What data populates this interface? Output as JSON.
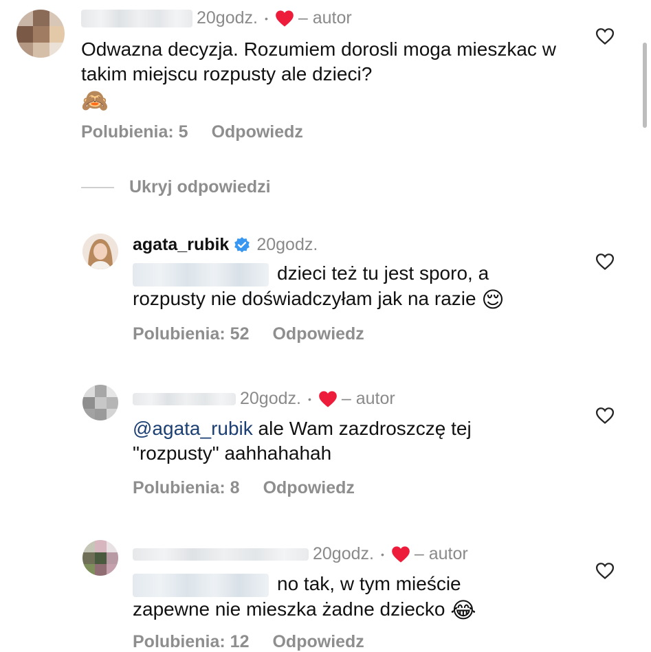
{
  "comments": [
    {
      "time": "20godz.",
      "author_label": "– autor",
      "text": "Odwazna decyzja. Rozumiem dorosli moga mieszkac w takim miejscu rozpusty ale dzieci?",
      "emoji": "🙈",
      "likes_label": "Polubienia: 5",
      "reply_label": "Odpowiedz"
    }
  ],
  "hide_replies_label": "Ukryj odpowiedzi",
  "replies": [
    {
      "username": "agata_rubik",
      "verified": true,
      "time": "20godz.",
      "text_line1": "dzieci też tu jest sporo, a",
      "text_line2": "rozpusty nie doświadczyłam jak na razie",
      "emoji": "😌",
      "likes_label": "Polubienia: 52",
      "reply_label": "Odpowiedz"
    },
    {
      "time": "20godz.",
      "author_label": "– autor",
      "mention": "@agata_rubik",
      "text_line1": " ale Wam zazdroszczę tej",
      "text_line2": "\"rozpusty\" aahhahahah",
      "likes_label": "Polubienia: 8",
      "reply_label": "Odpowiedz"
    },
    {
      "time": "20godz.",
      "author_label": "– autor",
      "text_line1": "no tak, w tym mieście",
      "text_line2": "zapewne nie mieszka żadne dziecko",
      "emoji": "😂",
      "likes_label": "Polubienia: 12",
      "reply_label": "Odpowiedz"
    }
  ],
  "colors": {
    "heart": "#ed1c3a",
    "verified": "#3897f0",
    "mention": "#1b3f72",
    "secondary": "#8e8e8e"
  }
}
